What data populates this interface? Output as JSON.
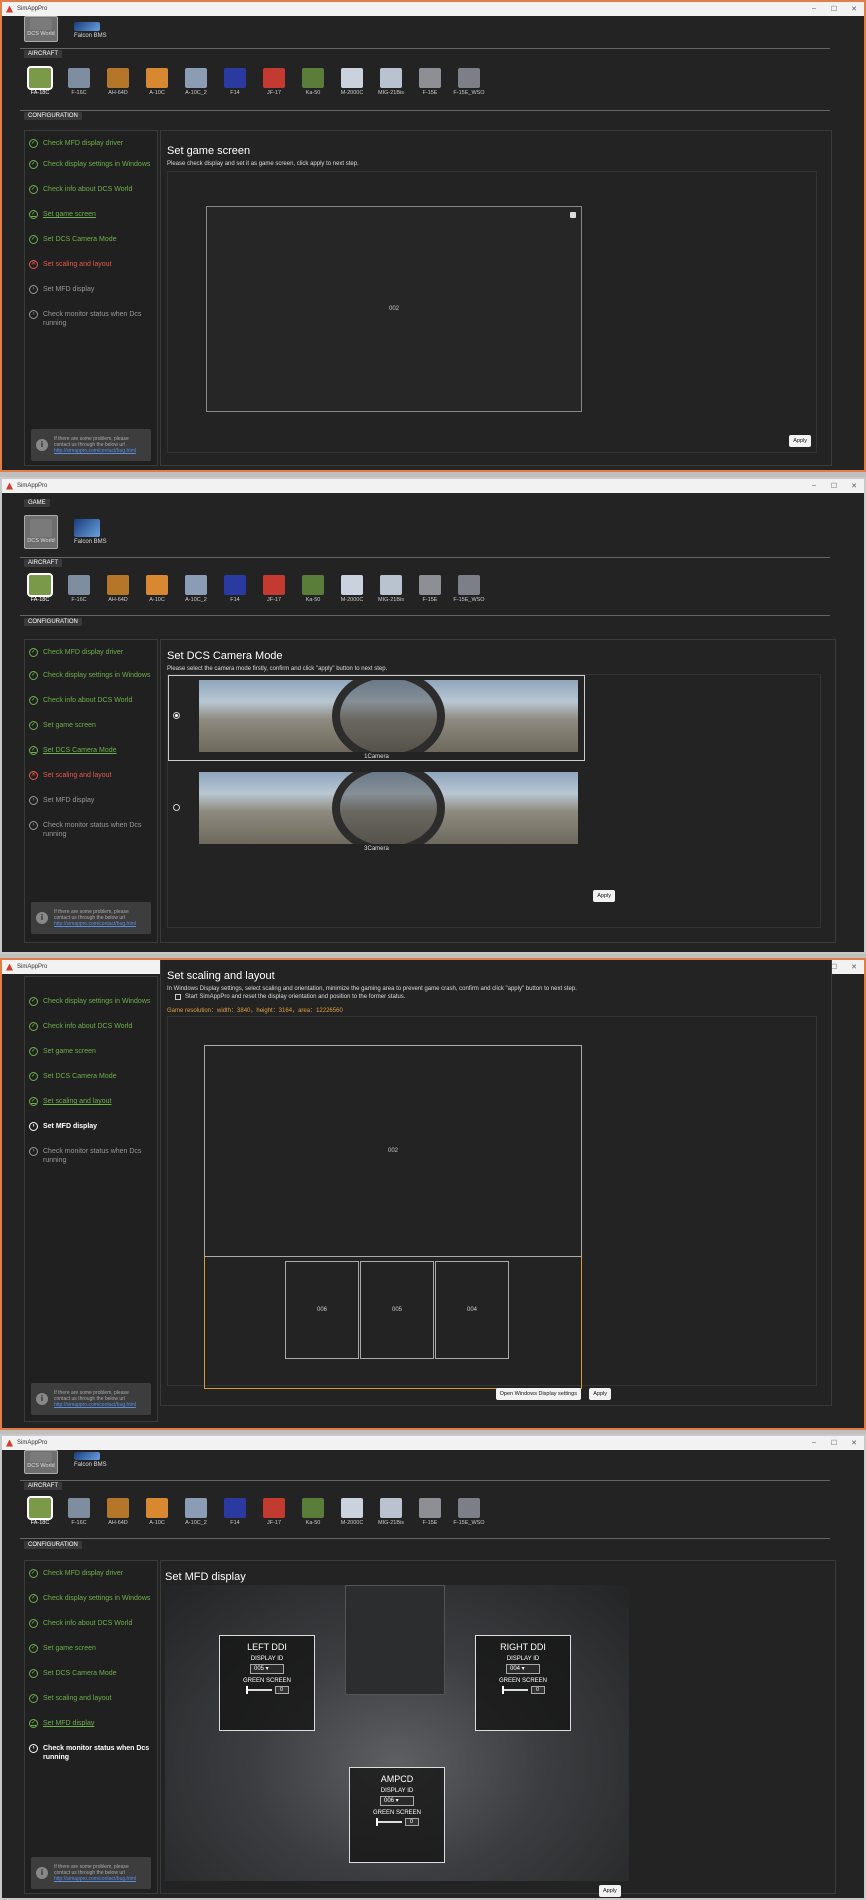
{
  "app_title": "SimAppPro",
  "window_controls": [
    "–",
    "☐",
    "✕"
  ],
  "sections": {
    "game": "GAME",
    "aircraft": "AIRCRAFT",
    "configuration": "CONFIGURATION"
  },
  "games": [
    {
      "label": "DCS World",
      "icon": "dcs-world-icon"
    },
    {
      "label": "Falcon BMS",
      "icon": "falcon-bms-icon"
    }
  ],
  "aircraft": [
    {
      "label": "FA-18C",
      "color": "#7a9a4a"
    },
    {
      "label": "F-16C",
      "color": "#7e8da0"
    },
    {
      "label": "AH-64D",
      "color": "#b5762a"
    },
    {
      "label": "A-10C",
      "color": "#d88830"
    },
    {
      "label": "A-10C_2",
      "color": "#8a9db5"
    },
    {
      "label": "F14",
      "color": "#2a3aa0"
    },
    {
      "label": "JF-17",
      "color": "#c23a30"
    },
    {
      "label": "Ka-50",
      "color": "#5b7d3a"
    },
    {
      "label": "M-2000C",
      "color": "#c9d2dd"
    },
    {
      "label": "MIG-21Bis",
      "color": "#b8c3cf"
    },
    {
      "label": "F-15E",
      "color": "#8d8f95"
    },
    {
      "label": "F-15E_WSO",
      "color": "#7c7f88"
    }
  ],
  "steps": [
    "Check MFD display driver",
    "Check display settings in Windows",
    "Check info about DCS World",
    "Set game screen",
    "Set DCS Camera Mode",
    "Set scaling and layout",
    "Set MFD display",
    "Check monitor status when Dcs running"
  ],
  "help": {
    "text": "If there are some problem, please contact us through the below url",
    "link": "http://simappro.com/contact/bug.html"
  },
  "apply": "Apply",
  "s1": {
    "title": "Set game screen",
    "desc": "Please check display and set it as game screen, click apply to next step.",
    "screen_id": "002"
  },
  "s2": {
    "title": "Set DCS Camera Mode",
    "desc": "Please select the camera mode firstly, confirm and click \"apply\" button to next step.",
    "opt1": "1Camera",
    "opt2": "3Camera"
  },
  "s3": {
    "title": "Set scaling and layout",
    "desc": "In Windows Display settings, select scaling and orientation, minimize the gaming area to prevent game crash, confirm and click \"apply\" button to next step.",
    "bullet": "Start SimAppPro and reset the display orientation and position to the former status.",
    "resolution": "Game resolution：width：3840，height：3164，area：12226560",
    "main_id": "002",
    "mfd_ids": [
      "006",
      "005",
      "004"
    ],
    "open_settings": "Open Windows Display settings"
  },
  "s4": {
    "title": "Set MFD display",
    "left": {
      "title": "LEFT DDI",
      "display_label": "DISPLAY ID",
      "display_value": "005",
      "green_label": "GREEN SCREEN",
      "green_value": "0"
    },
    "right": {
      "title": "RIGHT DDI",
      "display_label": "DISPLAY ID",
      "display_value": "004",
      "green_label": "GREEN SCREEN",
      "green_value": "0"
    },
    "ampcd": {
      "title": "AMPCD",
      "display_label": "DISPLAY ID",
      "display_value": "006",
      "green_label": "GREEN SCREEN",
      "green_value": "0"
    }
  }
}
